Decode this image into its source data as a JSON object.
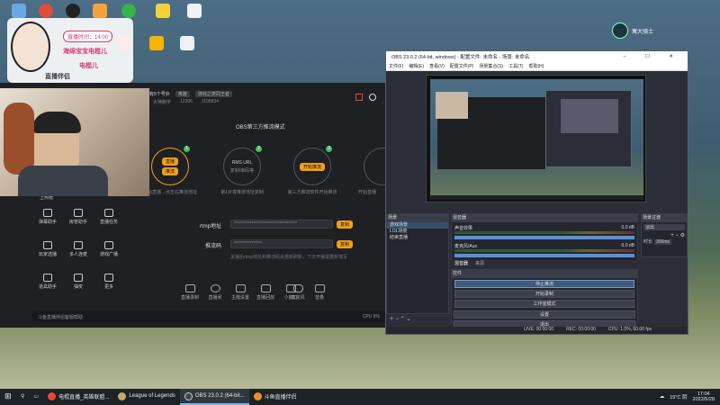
{
  "desktop": {
    "icons_row1": [
      "",
      "",
      "",
      "",
      "",
      "",
      "",
      "",
      ""
    ],
    "icon_labels": [
      "",
      "",
      "",
      "",
      "",
      "",
      "",
      ""
    ],
    "icon_right_label": "寓大骑士"
  },
  "overlay": {
    "time_text": "直播时间：14:00",
    "brand_text": "海绵宝宝电棍儿",
    "nick_text": "电棍儿",
    "logo_text": "直播伴侣"
  },
  "streamer_app": {
    "title": "直播：还有5个号外",
    "tag1": "英雄",
    "tag2": "游戏之类同王者",
    "stat1": "大神跑学",
    "stat2": "12306",
    "stat3": "1198834",
    "heading": "OBS第三方推流模式",
    "steps": [
      {
        "num": "1",
        "btn1": "直播",
        "btn2": "推流",
        "caption": "开始直播→点击右推流地址"
      },
      {
        "num": "2",
        "top": "RMS URL",
        "bottom": "复制/串码等",
        "caption": "第1步将推流地址复制"
      },
      {
        "num": "3",
        "top": "开始推流",
        "caption": "第三方推流软件开始推流"
      },
      {
        "num": "4",
        "caption": "开始直播"
      }
    ],
    "rtmp_label": "rtmp地址",
    "rtmp_value": "************************************",
    "rtmp_copy": "复制",
    "key_label": "推流码",
    "key_value": "****************",
    "key_copy": "复制",
    "hint": "关播后rtmp地址和推流码会重新刷新，下次开播需重新填写",
    "left_menu": [
      "弹幕助手",
      "房管助手",
      "直播任务",
      "玩家选播",
      "多人连麦",
      "游戏广播",
      "道具助手",
      "抽奖",
      "更多"
    ],
    "left_top": "上热榜",
    "bottom_tools": [
      "直播录制",
      "直播间",
      "主题设置",
      "直播回放",
      "小窗口",
      "麦克风",
      "音量"
    ],
    "bottom_tip": "斗鱼直播伴侣客服帮助",
    "bottom_right": "CPU 8%"
  },
  "obs": {
    "title": "OBS 23.0.2 (64-bit, windows) - 配置文件: 未命名 - 场景: 未命名",
    "menu": [
      "文件(F)",
      "编辑(E)",
      "查看(V)",
      "配置文件(P)",
      "场景集合(S)",
      "工具(T)",
      "帮助(H)"
    ],
    "scenes_header": "场景",
    "scenes": [
      "游戏场景",
      "LOL场景",
      "结束直播"
    ],
    "sources_header": "混音器",
    "mixer_items": [
      {
        "name": "声音效果",
        "value": "0.0 dB"
      },
      {
        "name": "麦克风/Aux",
        "value": "0.0 dB"
      }
    ],
    "tabs": [
      "混音器",
      "来源"
    ],
    "transition_header": "场景过渡",
    "transition_type": "淡出",
    "duration_label": "时长",
    "duration_value": "300ms",
    "controls_header": "控件",
    "controls": [
      "停止推流",
      "开始录制",
      "工作室模式",
      "设置",
      "退出"
    ],
    "status": {
      "live": "LIVE: 00:00:00",
      "rec": "REC: 00:00:00",
      "cpu": "CPU: 1.0%, 60.00 fps"
    }
  },
  "taskbar": {
    "items": [
      {
        "label": "电棍直播_英雄联盟...",
        "color": "#e9463b",
        "active": false
      },
      {
        "label": "League of Legends",
        "color": "#c9a86a",
        "active": false
      },
      {
        "label": "OBS 23.0.2 (64-bit...",
        "color": "#444",
        "active": true
      },
      {
        "label": "斗鱼直播伴侣",
        "color": "#f08c2a",
        "active": false
      }
    ],
    "weather": "19°C 阴",
    "time": "17:04",
    "date": "2022/5/28"
  }
}
